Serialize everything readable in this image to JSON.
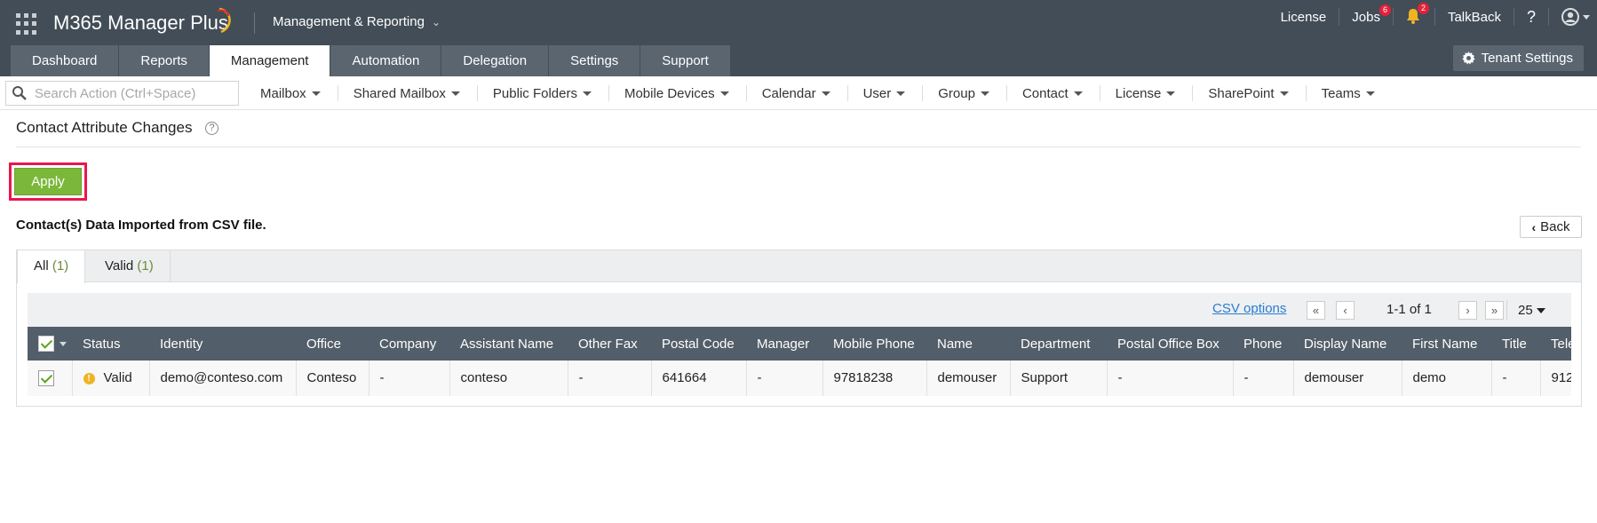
{
  "header": {
    "brand": "M365 Manager Plus",
    "module": "Management & Reporting",
    "links": {
      "license": "License",
      "jobs": "Jobs",
      "jobs_badge": "6",
      "alerts_badge": "2",
      "talkback": "TalkBack",
      "help": "?"
    },
    "colors": {
      "header_bg": "#424d57",
      "tab_bg": "#5a6570",
      "badge": "#e5203a"
    }
  },
  "tabs": [
    {
      "label": "Dashboard"
    },
    {
      "label": "Reports"
    },
    {
      "label": "Management",
      "active": true
    },
    {
      "label": "Automation"
    },
    {
      "label": "Delegation"
    },
    {
      "label": "Settings"
    },
    {
      "label": "Support"
    }
  ],
  "tenant_settings": "Tenant Settings",
  "subnav": {
    "search_placeholder": "Search Action (Ctrl+Space)",
    "menus": [
      "Mailbox",
      "Shared Mailbox",
      "Public Folders",
      "Mobile Devices",
      "Calendar",
      "User",
      "Group",
      "Contact",
      "License",
      "SharePoint",
      "Teams"
    ]
  },
  "page": {
    "title": "Contact Attribute Changes",
    "help": "?",
    "apply": "Apply",
    "section_title": "Contact(s) Data Imported from CSV file.",
    "back": "Back",
    "apply_color": "#7bb83a",
    "highlight_color": "#e8174e"
  },
  "grid": {
    "tabs": [
      {
        "label": "All",
        "count": "(1)",
        "active": true
      },
      {
        "label": "Valid",
        "count": "(1)"
      }
    ],
    "toolbar": {
      "csv_options": "CSV options",
      "range": "1-1 of 1",
      "page_size": "25"
    },
    "columns": [
      "Status",
      "Identity",
      "Office",
      "Company",
      "Assistant Name",
      "Other Fax",
      "Postal Code",
      "Manager",
      "Mobile Phone",
      "Name",
      "Department",
      "Postal Office Box",
      "Phone",
      "Display Name",
      "First Name",
      "Title",
      "Tele"
    ],
    "rows": [
      [
        "Valid",
        "demo@conteso.com",
        "Conteso",
        "-",
        "conteso",
        "-",
        "641664",
        "-",
        "97818238",
        "demouser",
        "Support",
        "-",
        "-",
        "demouser",
        "demo",
        "-",
        "912"
      ]
    ]
  }
}
